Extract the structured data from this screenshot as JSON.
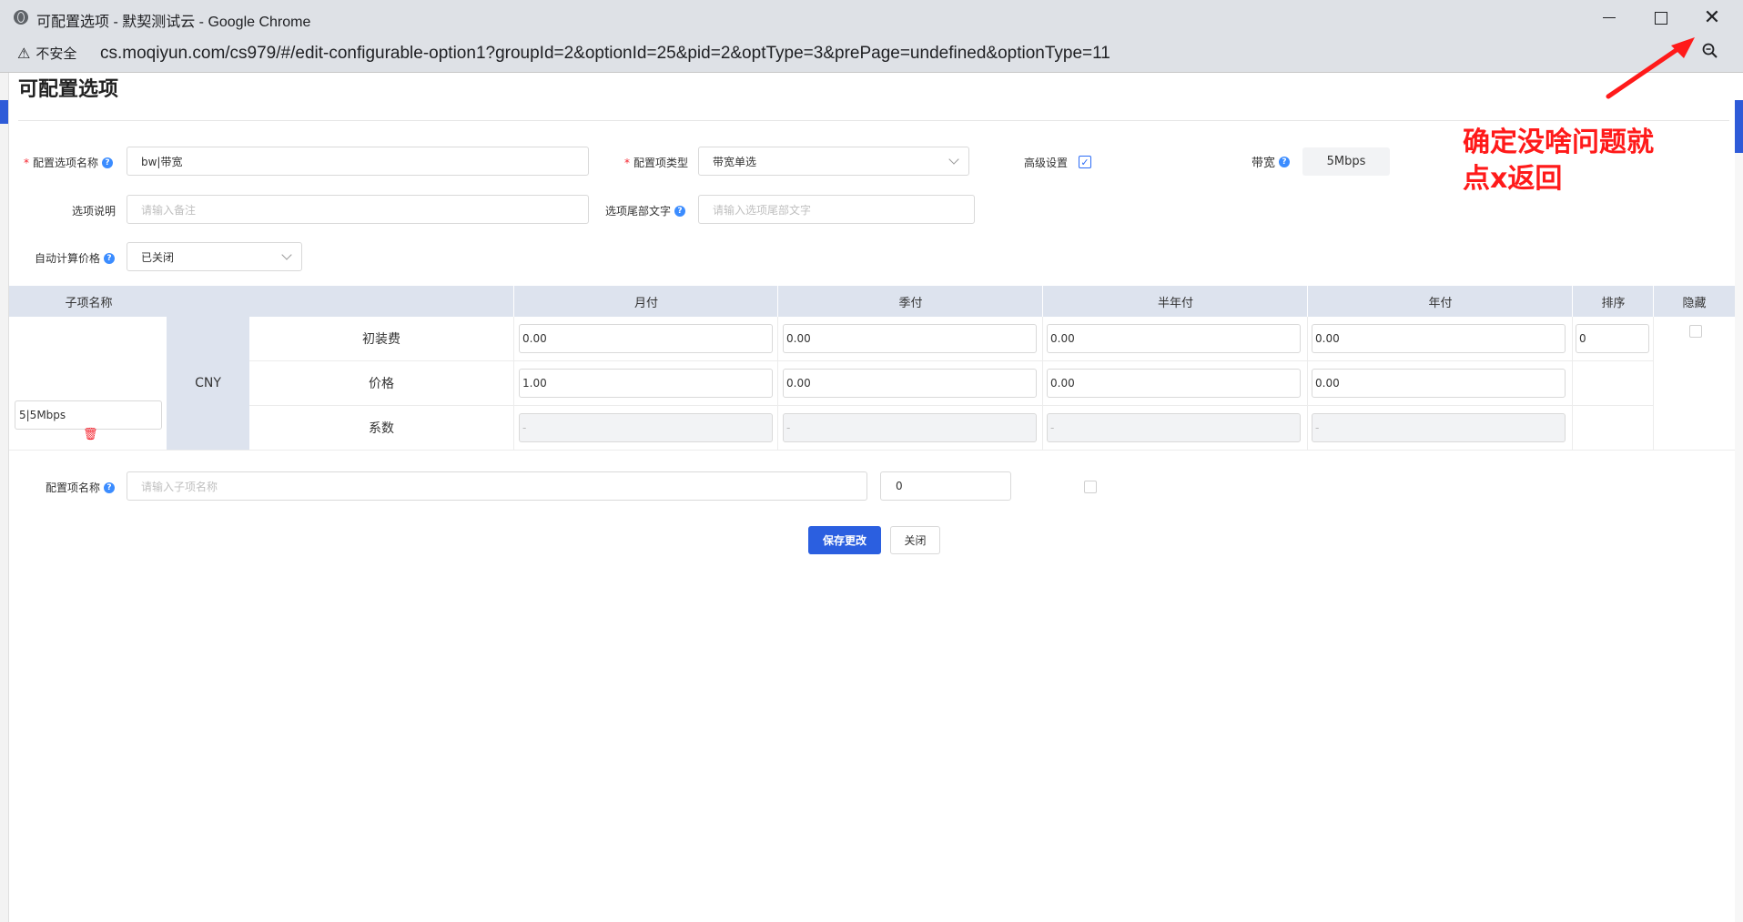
{
  "window": {
    "title": "可配置选项 - 默契测试云 - Google Chrome",
    "min_icon": "minimize-icon",
    "max_icon": "maximize-icon",
    "close_icon": "close-icon"
  },
  "address": {
    "security_label": "不安全",
    "url": "cs.moqiyun.com/cs979/#/edit-configurable-option1?groupId=2&optionId=25&pid=2&optType=3&prePage=undefined&optionType=11"
  },
  "page": {
    "title": "可配置选项"
  },
  "form": {
    "option_name_label": "配置选项名称",
    "option_name_value": "bw|带宽",
    "option_type_label": "配置项类型",
    "option_type_value": "带宽单选",
    "advanced_label": "高级设置",
    "advanced_checked": true,
    "bandwidth_label": "带宽",
    "bandwidth_value": "5Mbps",
    "desc_label": "选项说明",
    "desc_placeholder": "请输入备注",
    "suffix_label": "选项尾部文字",
    "suffix_placeholder": "请输入选项尾部文字",
    "auto_price_label": "自动计算价格",
    "auto_price_value": "已关闭"
  },
  "annotation": {
    "text": "确定没啥问题就点x返回",
    "color": "#ff1a1a"
  },
  "table": {
    "headers": {
      "sub_name": "子项名称",
      "monthly": "月付",
      "quarterly": "季付",
      "semiannual": "半年付",
      "annual": "年付",
      "sort": "排序",
      "hidden": "隐藏"
    },
    "currency": "CNY",
    "row_labels": {
      "setup": "初装费",
      "price": "价格",
      "coef": "系数"
    },
    "sub_item_name": "5|5Mbps",
    "setup": [
      "0.00",
      "0.00",
      "0.00",
      "0.00"
    ],
    "price": [
      "1.00",
      "0.00",
      "0.00",
      "0.00"
    ],
    "coef": [
      "-",
      "-",
      "-",
      "-"
    ],
    "sort_value": "0"
  },
  "new_item": {
    "label": "配置项名称",
    "name_placeholder": "请输入子项名称",
    "sort_value": "0"
  },
  "buttons": {
    "save": "保存更改",
    "close": "关闭"
  },
  "colors": {
    "primary": "#2b5fe0",
    "table_header": "#dde3ee",
    "danger": "#f5222d"
  }
}
